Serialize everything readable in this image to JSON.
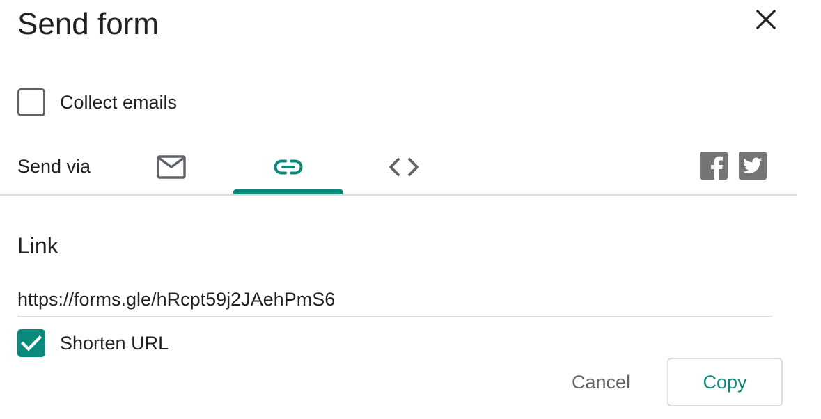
{
  "dialog": {
    "title": "Send form",
    "close_icon": "close-icon"
  },
  "collect_emails": {
    "label": "Collect emails",
    "checked": false
  },
  "send_via": {
    "label": "Send via",
    "tabs": [
      {
        "name": "email",
        "icon": "mail-icon",
        "selected": false
      },
      {
        "name": "link",
        "icon": "link-icon",
        "selected": true
      },
      {
        "name": "embed",
        "icon": "code-icon",
        "selected": false
      }
    ],
    "social": [
      {
        "name": "facebook",
        "icon": "facebook-icon"
      },
      {
        "name": "twitter",
        "icon": "twitter-icon"
      }
    ]
  },
  "link_section": {
    "title": "Link",
    "url": "https://forms.gle/hRcpt59j2JAehPmS6",
    "shorten_label": "Shorten URL",
    "shorten_checked": true
  },
  "actions": {
    "cancel_label": "Cancel",
    "copy_label": "Copy"
  },
  "colors": {
    "accent": "#0a8a7b",
    "icon_gray": "#5f6368",
    "social_gray": "#757575",
    "divider": "#dadce0"
  }
}
